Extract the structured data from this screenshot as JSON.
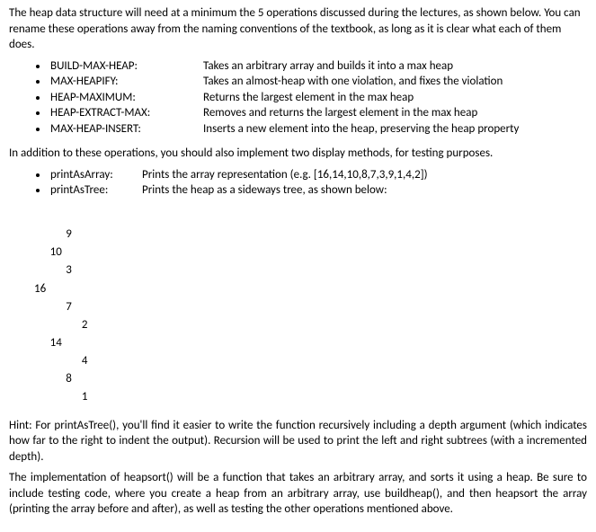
{
  "intro": "The heap data structure will need at a minimum the 5 operations discussed during the lectures, as shown below.  You can rename these operations away from the naming conventions of the textbook, as long as it is clear what each of them does.",
  "operations": [
    {
      "name": "BUILD-MAX-HEAP:",
      "desc": "Takes an arbitrary array and builds it into a max heap"
    },
    {
      "name": "MAX-HEAPIFY:",
      "desc": "Takes an almost-heap with one violation, and fixes the violation"
    },
    {
      "name": "HEAP-MAXIMUM:",
      "desc": "Returns the largest element in the max heap"
    },
    {
      "name": "HEAP-EXTRACT-MAX:",
      "desc": "Removes and returns the largest element in the max heap"
    },
    {
      "name": "MAX-HEAP-INSERT:",
      "desc": "Inserts a new element into the heap, preserving the heap property"
    }
  ],
  "display_intro": "In addition to these operations, you should also implement two display methods, for testing purposes.",
  "display_methods": [
    {
      "name": "printAsArray:",
      "desc": "Prints the array representation (e.g. [16,14,10,8,7,3,9,1,4,2])"
    },
    {
      "name": "printAsTree:",
      "desc": "Prints the heap as a sideways tree, as shown below:"
    }
  ],
  "tree_lines": [
    "            9",
    "      10",
    "            3",
    "16",
    "            7",
    "                  2",
    "      14",
    "                  4",
    "            8",
    "                  1"
  ],
  "hint": "Hint: For printAsTree(), you'll find it easier to write the function recursively including a depth argument (which indicates how far to the right to indent the output).  Recursion will be used to print the left and right subtrees (with a incremented depth).",
  "impl": "The implementation of heapsort() will be a function that takes an arbitrary array, and sorts it using a heap.  Be sure to include testing code, where you create a heap from an arbitrary array, use buildheap(), and then heapsort the array (printing the array before and after), as well as testing the other operations mentioned above."
}
